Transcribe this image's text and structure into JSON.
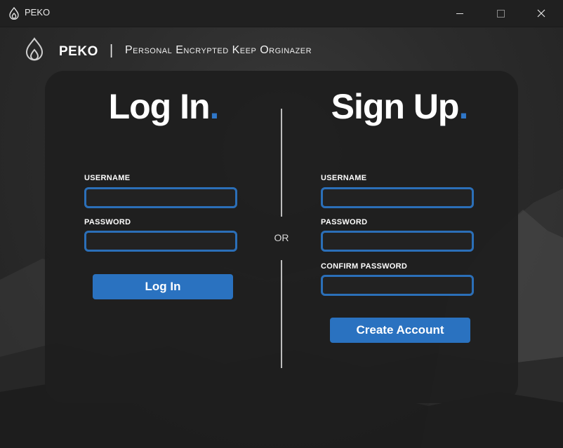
{
  "window": {
    "title": "PEKO",
    "icon": "flame-icon"
  },
  "header": {
    "app_name": "PEKO",
    "separator": "|",
    "subtitle": "Personal Encrypted Keep Orginazer"
  },
  "login": {
    "heading": "Log In",
    "heading_dot": ".",
    "username_label": "USERNAME",
    "username_value": "",
    "password_label": "PASSWORD",
    "password_value": "",
    "button_label": "Log In"
  },
  "divider": {
    "or_label": "OR"
  },
  "signup": {
    "heading": "Sign Up",
    "heading_dot": ".",
    "username_label": "USERNAME",
    "username_value": "",
    "password_label": "PASSWORD",
    "password_value": "",
    "confirm_label": "CONFIRM PASSWORD",
    "confirm_value": "",
    "button_label": "Create Account"
  },
  "colors": {
    "accent": "#2a72c0",
    "input_border": "#2b6fb8",
    "titlebar": "#202020",
    "card": "#1e1e1e"
  }
}
